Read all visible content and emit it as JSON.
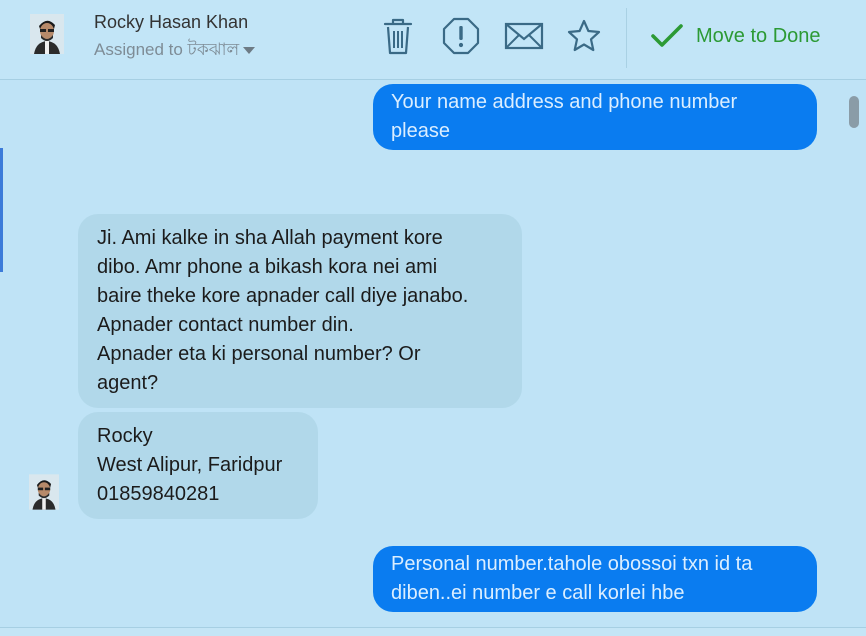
{
  "header": {
    "contact_name": "Rocky Hasan Khan",
    "assigned_label": "Assigned to টকঝাল",
    "tools": [
      {
        "name": "delete",
        "icon": "trash-icon"
      },
      {
        "name": "report",
        "icon": "alert-circle-icon"
      },
      {
        "name": "mark-unread",
        "icon": "envelope-icon"
      },
      {
        "name": "star",
        "icon": "star-icon"
      }
    ],
    "done_label": "Move to Done"
  },
  "colors": {
    "outgoing_bubble": "#0a7cf0",
    "incoming_bubble": "#b1d8ea",
    "background": "#bfe3f6",
    "done_green": "#2c9a35"
  },
  "messages": [
    {
      "direction": "outgoing",
      "text": "Your name address and phone number\nplease"
    },
    {
      "direction": "incoming",
      "text": "Ji. Ami kalke in sha Allah payment kore\ndibo. Amr phone a bikash kora nei ami\nbaire theke kore apnader call diye janabo.\nApnader contact number din.\nApnader eta ki personal number? Or\nagent?"
    },
    {
      "direction": "incoming",
      "text": "Rocky\nWest Alipur, Faridpur\n01859840281"
    },
    {
      "direction": "outgoing",
      "text": "Personal number.tahole obossoi txn id ta\ndiben..ei number e call korlei hbe"
    }
  ]
}
